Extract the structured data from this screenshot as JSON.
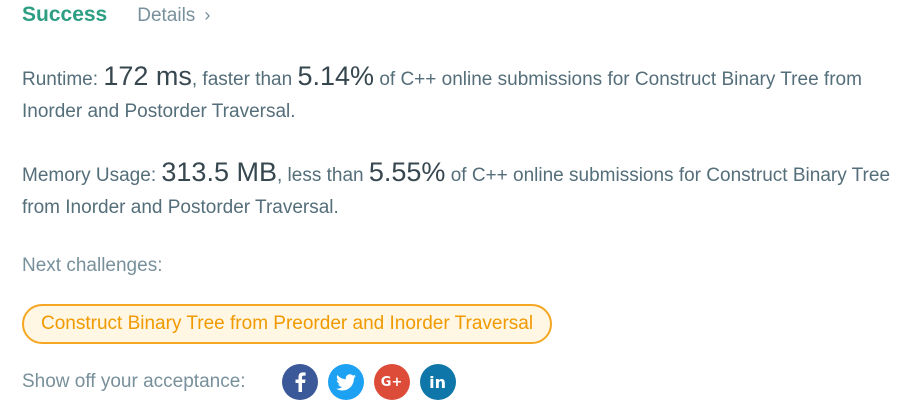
{
  "status": {
    "label": "Success",
    "details_label": "Details",
    "details_chevron": "›"
  },
  "runtime": {
    "label": "Runtime:",
    "value": "172 ms",
    "comparison": ", faster than",
    "percent": "5.14%",
    "suffix": "of C++ online submissions for Construct Binary Tree from Inorder and Postorder Traversal."
  },
  "memory": {
    "label": "Memory Usage:",
    "value": "313.5 MB",
    "comparison": ", less than",
    "percent": "5.55%",
    "suffix": "of C++ online submissions for Construct Binary Tree from Inorder and Postorder Traversal."
  },
  "next": {
    "label": "Next challenges:",
    "challenges": [
      "Construct Binary Tree from Preorder and Inorder Traversal"
    ]
  },
  "share": {
    "label": "Show off your acceptance:",
    "icons": [
      "facebook-icon",
      "twitter-icon",
      "google-plus-icon",
      "linkedin-icon"
    ],
    "gplus_glyph": "G+",
    "linkedin_glyph": "in"
  },
  "colors": {
    "success": "#2e9e83",
    "challenge_border": "#f5a623",
    "challenge_bg": "#fff6e3",
    "facebook": "#3b5998",
    "twitter": "#1da1f2",
    "google_plus": "#dd4b39",
    "linkedin": "#0e76a8"
  }
}
